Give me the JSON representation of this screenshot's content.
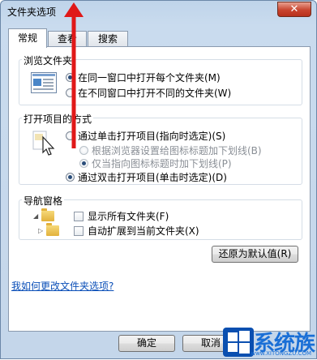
{
  "window": {
    "title": "文件夹选项",
    "close_label": "✕"
  },
  "tabs": [
    {
      "label": "常规"
    },
    {
      "label": "查看"
    },
    {
      "label": "搜索"
    }
  ],
  "browse_folders": {
    "legend": "浏览文件夹",
    "options": [
      {
        "label": "在同一窗口中打开每个文件夹(M)",
        "checked": true
      },
      {
        "label": "在不同窗口中打开不同的文件夹(W)",
        "checked": false
      }
    ]
  },
  "open_items": {
    "legend": "打开项目的方式",
    "options": [
      {
        "label": "通过单击打开项目(指向时选定)(S)",
        "checked": false,
        "disabled": false
      },
      {
        "label": "根据浏览器设置给图标标题加下划线(B)",
        "checked": false,
        "disabled": true
      },
      {
        "label": "仅当指向图标标题时加下划线(P)",
        "checked": true,
        "disabled": true
      },
      {
        "label": "通过双击打开项目(单击时选定)(D)",
        "checked": true,
        "disabled": false
      }
    ]
  },
  "navigation_pane": {
    "legend": "导航窗格",
    "options": [
      {
        "label": "显示所有文件夹(F)",
        "checked": false
      },
      {
        "label": "自动扩展到当前文件夹(X)",
        "checked": false
      }
    ]
  },
  "restore_defaults_label": "还原为默认值(R)",
  "help_link": "我如何更改文件夹选项?",
  "buttons": {
    "ok": "确定",
    "cancel": "取消"
  },
  "watermark": {
    "text": "系统族",
    "sub": "www.XITONGZU.COM"
  },
  "colors": {
    "accent_arrow": "#e01818",
    "link": "#0b4fb8",
    "watermark": "#1a6fd6"
  }
}
